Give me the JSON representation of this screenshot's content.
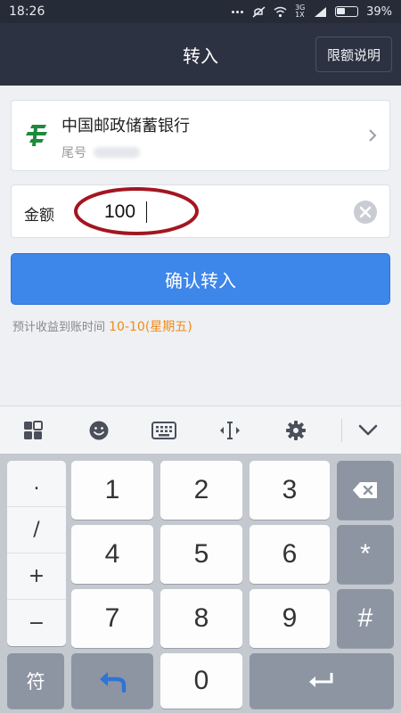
{
  "status_bar": {
    "time": "18:26",
    "network": "3G 1X",
    "battery": "39%"
  },
  "header": {
    "title": "转入",
    "limit_button": "限额说明"
  },
  "bank": {
    "name": "中国邮政储蓄银行",
    "tail_label": "尾号",
    "logo_icon": "postal-savings-bank-logo"
  },
  "amount": {
    "label": "金额",
    "value": "100"
  },
  "confirm": {
    "label": "确认转入"
  },
  "eta": {
    "prefix": "预计收益到账时间 ",
    "date": "10-10(星期五)"
  },
  "keyboard": {
    "toolbar_icons": [
      "grid-icon",
      "emoji-icon",
      "keyboard-icon",
      "cursor-move-icon",
      "gear-icon",
      "chevron-down-icon"
    ],
    "symbols": [
      ".",
      "/",
      "+",
      "−"
    ],
    "digits": [
      "1",
      "2",
      "3",
      "4",
      "5",
      "6",
      "7",
      "8",
      "9",
      "0"
    ],
    "star": "*",
    "hash": "#",
    "symbol_key": "符",
    "backspace_icon": "backspace-icon",
    "undo_icon": "undo-icon",
    "enter_icon": "enter-icon"
  },
  "colors": {
    "header_bg": "#2d3242",
    "accent_blue": "#3d86ea",
    "date_orange": "#f08a18",
    "annotation_red": "#a31620",
    "bank_green": "#1d8a3c"
  }
}
